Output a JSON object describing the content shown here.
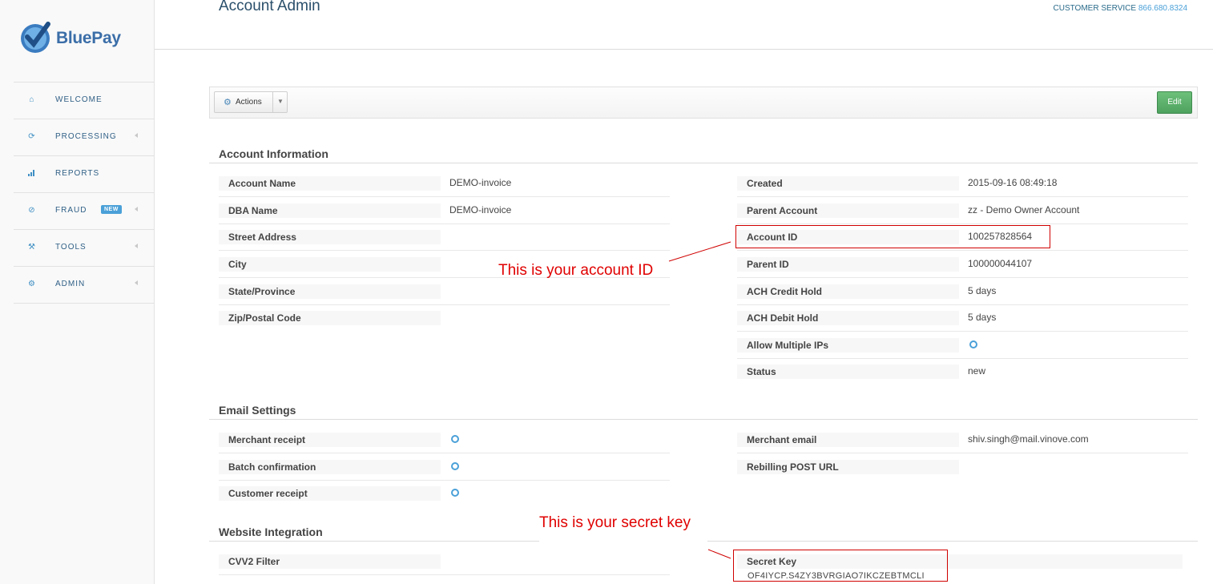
{
  "brand": {
    "name": "BluePay"
  },
  "sidebar": {
    "items": [
      {
        "label": "WELCOME",
        "icon": "home-icon"
      },
      {
        "label": "PROCESSING",
        "icon": "refresh-icon"
      },
      {
        "label": "REPORTS",
        "icon": "bar-chart-icon"
      },
      {
        "label": "FRAUD",
        "icon": "ban-icon",
        "badge": "NEW"
      },
      {
        "label": "TOOLS",
        "icon": "wrench-icon"
      },
      {
        "label": "ADMIN",
        "icon": "gear-icon"
      }
    ]
  },
  "header": {
    "title": "Account Admin",
    "customer_service_label": "CUSTOMER SERVICE",
    "customer_service_phone": "866.680.8324"
  },
  "toolbar": {
    "actions_label": "Actions",
    "edit_label": "Edit"
  },
  "account_info": {
    "title": "Account Information",
    "left": [
      {
        "label": "Account Name",
        "value": "DEMO-invoice"
      },
      {
        "label": "DBA Name",
        "value": "DEMO-invoice"
      },
      {
        "label": "Street Address",
        "value": ""
      },
      {
        "label": "City",
        "value": ""
      },
      {
        "label": "State/Province",
        "value": ""
      },
      {
        "label": "Zip/Postal Code",
        "value": ""
      }
    ],
    "right": [
      {
        "label": "Created",
        "value": "2015-09-16 08:49:18"
      },
      {
        "label": "Parent Account",
        "value": "zz - Demo Owner Account"
      },
      {
        "label": "Account ID",
        "value": "100257828564"
      },
      {
        "label": "Parent ID",
        "value": "100000044107"
      },
      {
        "label": "ACH Credit Hold",
        "value": "5 days"
      },
      {
        "label": "ACH Debit Hold",
        "value": "5 days"
      },
      {
        "label": "Allow Multiple IPs",
        "value": ""
      },
      {
        "label": "Status",
        "value": "new"
      }
    ]
  },
  "email_settings": {
    "title": "Email Settings",
    "left": [
      {
        "label": "Merchant receipt"
      },
      {
        "label": "Batch confirmation"
      },
      {
        "label": "Customer receipt"
      }
    ],
    "right": [
      {
        "label": "Merchant email",
        "value": "shiv.singh@mail.vinove.com"
      },
      {
        "label": "Rebilling POST URL",
        "value": ""
      }
    ]
  },
  "website_integration": {
    "title": "Website Integration",
    "left": [
      {
        "label": "CVV2 Filter"
      }
    ],
    "right": [
      {
        "label": "Secret Key",
        "value": "OF4IYCP.S4ZY3BVRGIAO7IKCZEBTMCLI"
      }
    ]
  },
  "annotations": {
    "account_id_note": "This is your account ID",
    "secret_key_note": "This is your secret key"
  }
}
